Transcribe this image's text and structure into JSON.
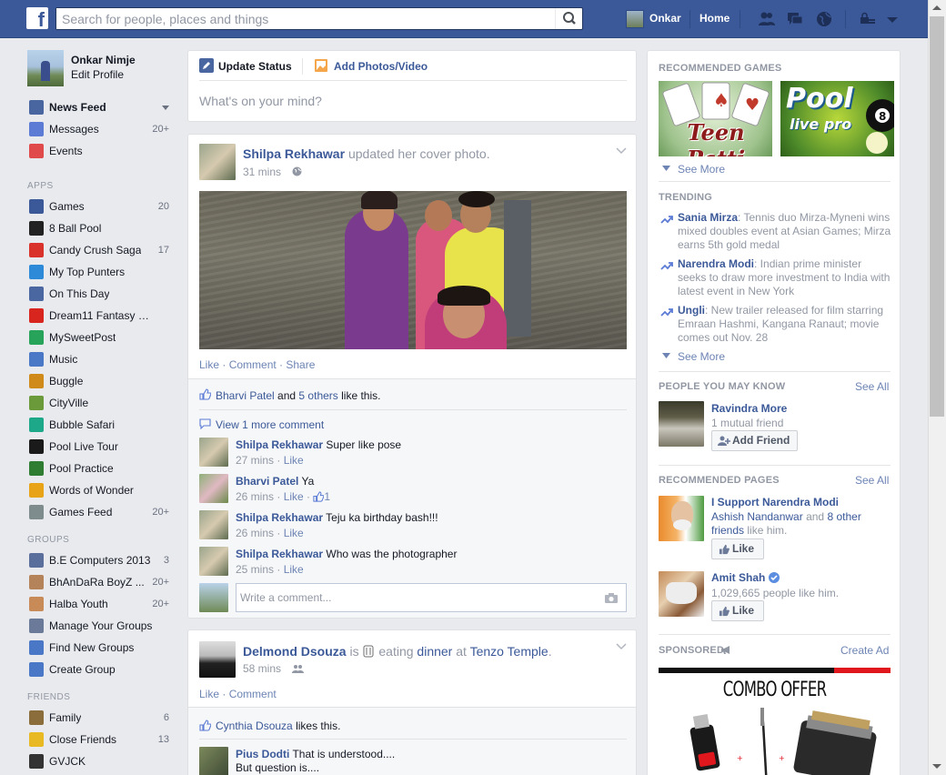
{
  "topbar": {
    "logo": "f",
    "search_placeholder": "Search for people, places and things",
    "user_name": "Onkar",
    "home_label": "Home"
  },
  "left_nav": {
    "profile": {
      "name": "Onkar Nimje",
      "edit": "Edit Profile"
    },
    "favorites": [
      {
        "label": "News Feed",
        "count": "",
        "icon": "news-feed-icon",
        "color": "#4a66a0"
      },
      {
        "label": "Messages",
        "count": "20+",
        "icon": "messages-icon",
        "color": "#5b7bd5"
      },
      {
        "label": "Events",
        "count": "",
        "icon": "events-icon",
        "color": "#e04a4a"
      }
    ],
    "apps_heading": "APPS",
    "apps": [
      {
        "label": "Games",
        "count": "20",
        "icon": "games-icon",
        "color": "#3b5998"
      },
      {
        "label": "8 Ball Pool",
        "count": "",
        "icon": "8-ball-pool-icon",
        "color": "#222222"
      },
      {
        "label": "Candy Crush Saga",
        "count": "17",
        "icon": "candy-crush-icon",
        "color": "#d9322b"
      },
      {
        "label": "My Top Punters",
        "count": "",
        "icon": "my-top-punters-icon",
        "color": "#2d8ad8"
      },
      {
        "label": "On This Day",
        "count": "",
        "icon": "on-this-day-icon",
        "color": "#4b67a1"
      },
      {
        "label": "Dream11 Fantasy Cri...",
        "count": "",
        "icon": "dream11-icon",
        "color": "#d8261f"
      },
      {
        "label": "MySweetPost",
        "count": "",
        "icon": "mysweetpost-icon",
        "color": "#27a35a"
      },
      {
        "label": "Music",
        "count": "",
        "icon": "music-icon",
        "color": "#4a78c7"
      },
      {
        "label": "Buggle",
        "count": "",
        "icon": "buggle-icon",
        "color": "#d08a1a"
      },
      {
        "label": "CityVille",
        "count": "",
        "icon": "cityville-icon",
        "color": "#6a9a3a"
      },
      {
        "label": "Bubble Safari",
        "count": "",
        "icon": "bubble-safari-icon",
        "color": "#1ea88a"
      },
      {
        "label": "Pool Live Tour",
        "count": "",
        "icon": "pool-live-tour-icon",
        "color": "#1a1a1a"
      },
      {
        "label": "Pool Practice",
        "count": "",
        "icon": "pool-practice-icon",
        "color": "#2e7d32"
      },
      {
        "label": "Words of Wonder",
        "count": "",
        "icon": "words-of-wonder-icon",
        "color": "#e8a317"
      },
      {
        "label": "Games Feed",
        "count": "20+",
        "icon": "games-feed-icon",
        "color": "#7f8c8d"
      }
    ],
    "groups_heading": "GROUPS",
    "groups": [
      {
        "label": "B.E Computers 2013",
        "count": "3",
        "icon": "group-icon",
        "color": "#5a6f9b"
      },
      {
        "label": "BhAnDaRa BoyZ ...",
        "count": "20+",
        "icon": "group-avatar-icon",
        "color": "#b5835a"
      },
      {
        "label": "Halba Youth",
        "count": "20+",
        "icon": "group-avatar-icon",
        "color": "#c88a56"
      },
      {
        "label": "Manage Your Groups",
        "count": "",
        "icon": "manage-groups-icon",
        "color": "#6b7a99"
      },
      {
        "label": "Find New Groups",
        "count": "",
        "icon": "find-groups-icon",
        "color": "#4a78c7"
      },
      {
        "label": "Create Group",
        "count": "",
        "icon": "create-group-icon",
        "color": "#4a78c7"
      }
    ],
    "friends_heading": "FRIENDS",
    "friends": [
      {
        "label": "Family",
        "count": "6",
        "icon": "family-icon",
        "color": "#8a6d3b"
      },
      {
        "label": "Close Friends",
        "count": "13",
        "icon": "close-friends-icon",
        "color": "#e8b923"
      },
      {
        "label": "GVJCK",
        "count": "",
        "icon": "graduation-icon",
        "color": "#333333"
      }
    ]
  },
  "composer": {
    "tab_status": "Update Status",
    "tab_photos": "Add Photos/Video",
    "placeholder": "What's on your mind?"
  },
  "post1": {
    "author": "Shilpa Rekhawar",
    "action": "updated her cover photo.",
    "time": "31 mins",
    "like": "Like",
    "comment": "Comment",
    "share": "Share",
    "likes_name": "Bharvi Patel",
    "likes_and": "and",
    "likes_others": "5 others",
    "likes_suffix": "like this.",
    "view_more": "View 1 more comment",
    "comments": [
      {
        "author": "Shilpa Rekhawar",
        "text": "Super like pose",
        "time": "27 mins",
        "like": "Like",
        "likes": ""
      },
      {
        "author": "Bharvi Patel",
        "text": "Ya",
        "time": "26 mins",
        "like": "Like",
        "likes": "1"
      },
      {
        "author": "Shilpa Rekhawar",
        "text": "Teju ka birthday bash!!!",
        "time": "26 mins",
        "like": "Like",
        "likes": ""
      },
      {
        "author": "Shilpa Rekhawar",
        "text": "Who was the photographer",
        "time": "25 mins",
        "like": "Like",
        "likes": ""
      }
    ],
    "write_placeholder": "Write a comment..."
  },
  "post2": {
    "author": "Delmond Dsouza",
    "is": "is",
    "eating": "eating",
    "dinner": "dinner",
    "at": "at",
    "place": "Tenzo Temple",
    "time": "58 mins",
    "like": "Like",
    "comment": "Comment",
    "likes_name": "Cynthia Dsouza",
    "likes_suffix": "likes this.",
    "comment1_author": "Pius Dodti",
    "comment1_text": "That is understood....",
    "comment1_text2": "But question is...."
  },
  "right": {
    "games_heading": "RECOMMENDED GAMES",
    "game1": "Teen Patti",
    "game2_line1": "Pool",
    "game2_line2": "live pro",
    "see_more": "See More",
    "trending_heading": "TRENDING",
    "trends": [
      {
        "name": "Sania Mirza",
        "text": ": Tennis duo Mirza-Myneni wins mixed doubles event at Asian Games; Mirza earns 5th gold medal"
      },
      {
        "name": "Narendra Modi",
        "text": ": Indian prime minister seeks to draw more investment to India with latest event in New York"
      },
      {
        "name": "Ungli",
        "text": ": New trailer released for film starring Emraan Hashmi, Kangana Ranaut; movie comes out Nov. 28"
      }
    ],
    "see_more2": "See More",
    "pymk_heading": "PEOPLE YOU MAY KNOW",
    "see_all": "See All",
    "pymk_name": "Ravindra More",
    "pymk_mutual": "1 mutual friend",
    "add_friend": "Add Friend",
    "pages_heading": "RECOMMENDED PAGES",
    "see_all2": "See All",
    "page1_name": "I Support Narendra Modi",
    "page1_friend": "Ashish Nandanwar",
    "page1_and": "and",
    "page1_others": "8 other friends",
    "page1_suffix": "like him.",
    "like_btn": "Like",
    "page2_name": "Amit Shah",
    "page2_likes": "1,029,665 people like him.",
    "sponsored_heading": "SPONSORED",
    "create_ad": "Create Ad",
    "ad_title": "COMBO OFFER",
    "colors": {
      "brand": "#3b5998",
      "link": "#3b5998",
      "muted": "#9197a3"
    }
  }
}
